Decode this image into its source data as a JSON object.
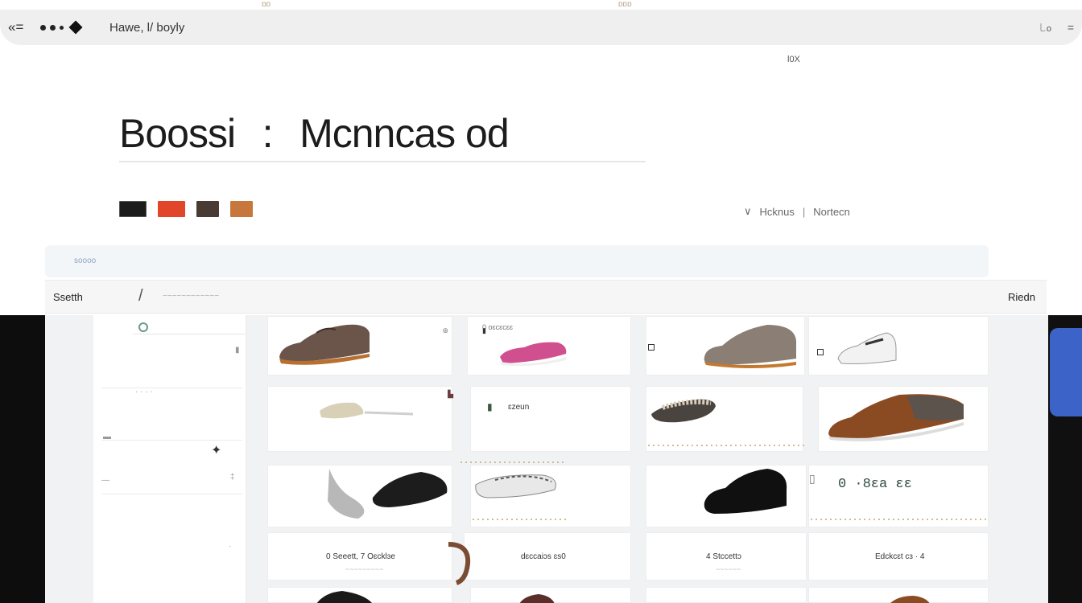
{
  "browser": {
    "back_icon": "back-arrow-icon",
    "title": "Hawe, l/ boyly",
    "right_text": "꒒o",
    "menu_icon": "menu-icon"
  },
  "page_info": "l0X",
  "hero": {
    "title_left": "Boossi",
    "separator": ":",
    "title_right": "Mcnncas od"
  },
  "sort": {
    "icon": "chevron-down-icon",
    "option_a": "Hcknus",
    "separator": "|",
    "option_b": "Nortecn"
  },
  "filter_strip": {
    "text": "soooo"
  },
  "search": {
    "label": "Ssetth",
    "right_label": "Riedn"
  },
  "products": {
    "row2_card2_label": "ɛzeun",
    "row3_card4_price": "0 ·8ɛa ɛɛ",
    "row4_card1_label": "0 Seeett, 7 Oɛcklɜe",
    "row4_card2_label": "dɛccaiɔs ɛs0",
    "row4_card3_label": "4 Stccettɔ",
    "row4_card4_label": "Edckcɛt cɜ · 4",
    "row1_card2_label": "0 oɛcɛcɛɛ"
  },
  "colors": {
    "accent_blue": "#3c63c8",
    "badge_dark": "#1b1b1b",
    "badge_orange": "#e2462a",
    "badge_brown": "#4a3a34",
    "badge_tan": "#c8773c"
  }
}
